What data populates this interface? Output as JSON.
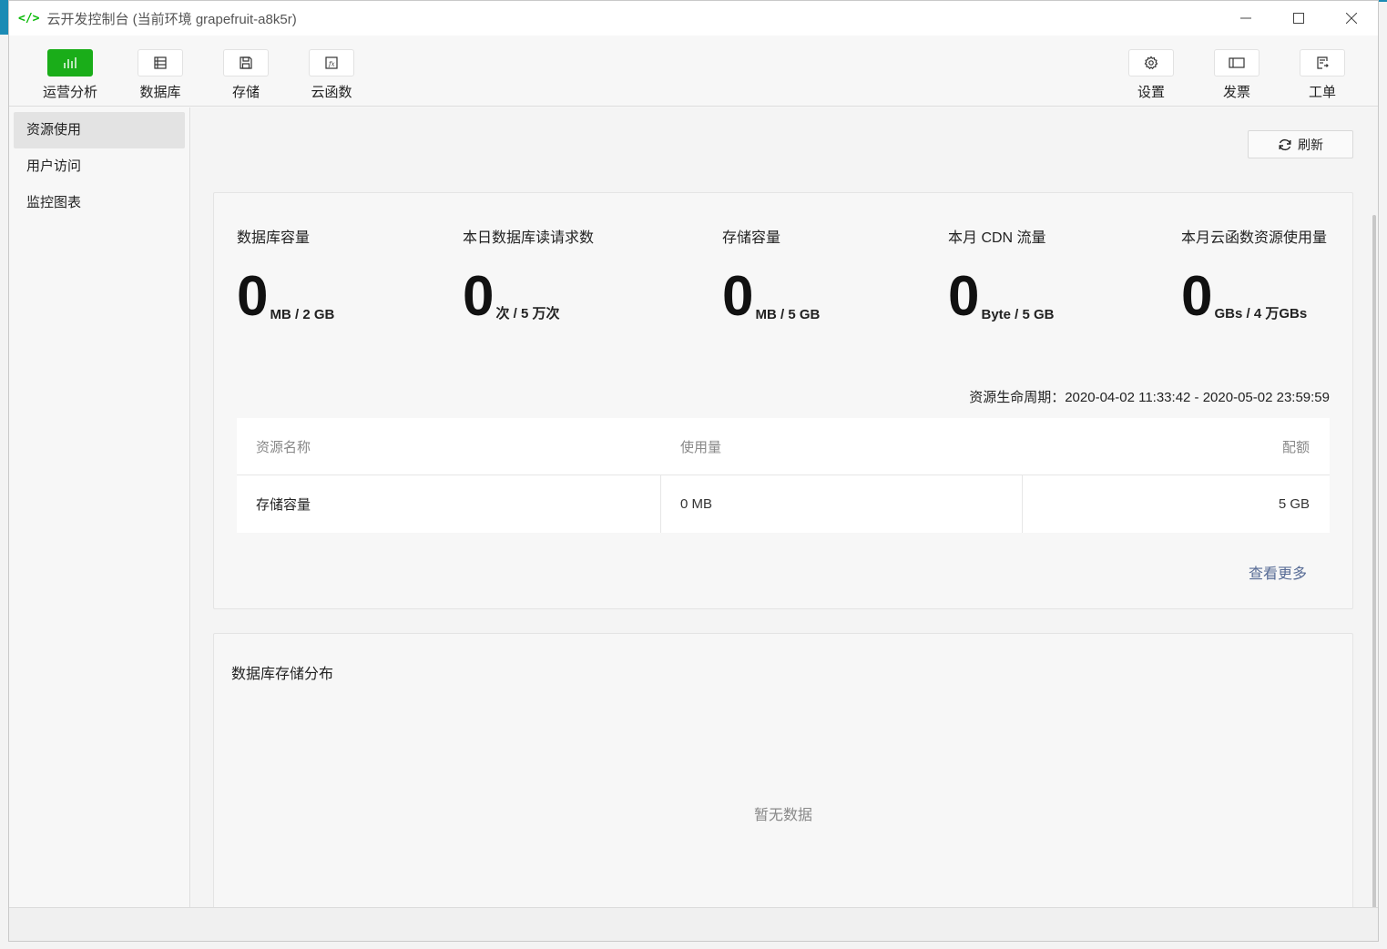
{
  "window": {
    "title": "云开发控制台 (当前环境 grapefruit-a8k5r)",
    "controls": [
      "—",
      "☐",
      "✕"
    ]
  },
  "toolbar": {
    "left": [
      {
        "label": "运营分析",
        "icon": "bar-chart-icon",
        "active": true
      },
      {
        "label": "数据库",
        "icon": "database-icon",
        "active": false
      },
      {
        "label": "存储",
        "icon": "storage-icon",
        "active": false
      },
      {
        "label": "云函数",
        "icon": "function-icon",
        "active": false
      }
    ],
    "right": [
      {
        "label": "设置",
        "icon": "gear-icon"
      },
      {
        "label": "发票",
        "icon": "invoice-icon"
      },
      {
        "label": "工单",
        "icon": "ticket-icon"
      }
    ]
  },
  "sidebar": {
    "items": [
      {
        "label": "资源使用",
        "active": true
      },
      {
        "label": "用户访问",
        "active": false
      },
      {
        "label": "监控图表",
        "active": false
      }
    ]
  },
  "main": {
    "refresh_label": "刷新",
    "metrics": [
      {
        "label": "数据库容量",
        "value": "0",
        "unit": "MB / 2 GB"
      },
      {
        "label": "本日数据库读请求数",
        "value": "0",
        "unit": "次 / 5 万次"
      },
      {
        "label": "存储容量",
        "value": "0",
        "unit": "MB / 5 GB"
      },
      {
        "label": "本月 CDN 流量",
        "value": "0",
        "unit": "Byte / 5 GB"
      },
      {
        "label": "本月云函数资源使用量",
        "value": "0",
        "unit": "GBs / 4 万GBs"
      }
    ],
    "lifecycle": "资源生命周期：2020-04-02 11:33:42 - 2020-05-02 23:59:59",
    "table": {
      "headers": [
        "资源名称",
        "使用量",
        "配额"
      ],
      "rows": [
        [
          "存储容量",
          "0 MB",
          "5 GB"
        ]
      ]
    },
    "more_label": "查看更多",
    "db_dist_title": "数据库存储分布",
    "empty_text": "暂无数据"
  },
  "colors": {
    "accent": "#1aad19",
    "link": "#576b95"
  }
}
